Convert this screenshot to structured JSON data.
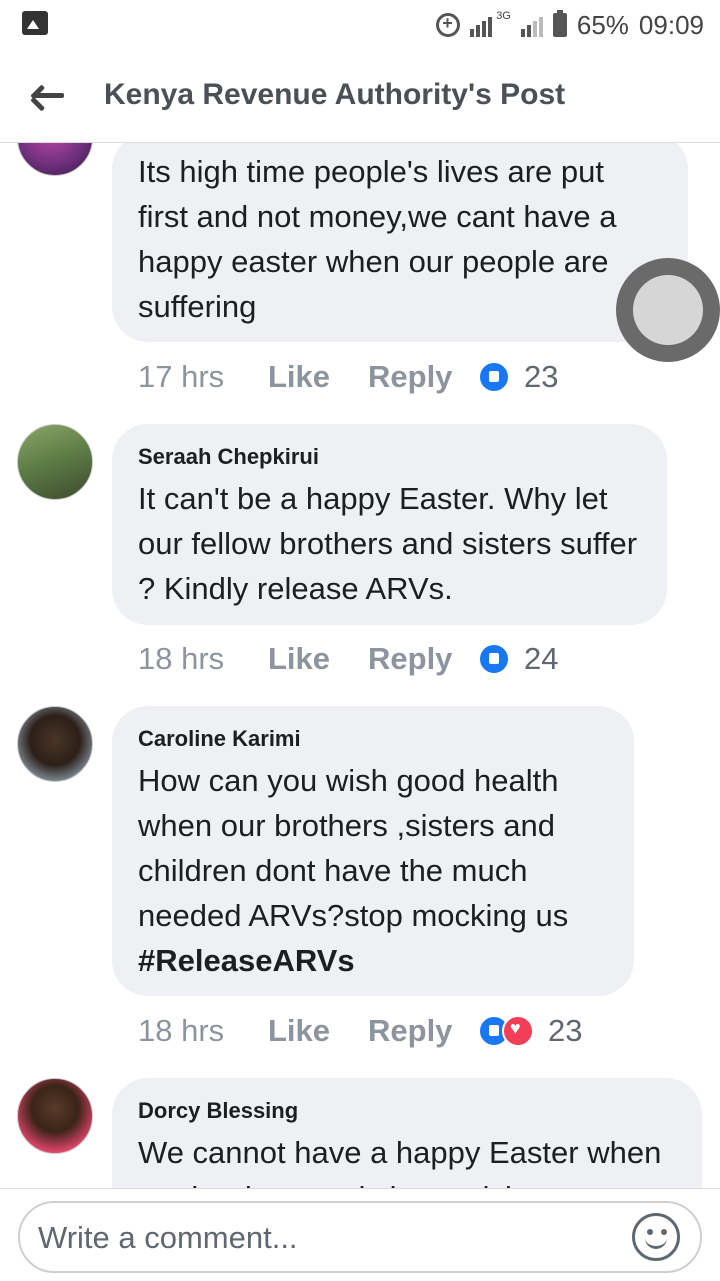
{
  "status_bar": {
    "battery": "65%",
    "time": "09:09",
    "network": "3G"
  },
  "app_bar": {
    "title": "Kenya Revenue Authority's Post"
  },
  "comments": [
    {
      "author": "",
      "text": "Its high time people's lives are put first and not money,we cant have a happy easter when our people are suffering",
      "time": "17 hrs",
      "like": "Like",
      "reply": "Reply",
      "reactions": [
        "like-icon"
      ],
      "count": "23"
    },
    {
      "author": "Seraah Chepkirui",
      "text": "It can't be a happy Easter. Why let our fellow brothers and sisters suffer ? Kindly release ARVs.",
      "time": "18 hrs",
      "like": "Like",
      "reply": "Reply",
      "reactions": [
        "like-icon"
      ],
      "count": "24"
    },
    {
      "author": "Caroline Karimi",
      "text": "How can you wish good health when our brothers ,sisters and children dont have the much needed ARVs?stop mocking us",
      "hashtag": "#ReleaseARVs",
      "time": "18 hrs",
      "like": "Like",
      "reply": "Reply",
      "reactions": [
        "like-icon",
        "love-icon"
      ],
      "count": "23"
    },
    {
      "author": "Dorcy Blessing",
      "text": "We cannot have a happy Easter when our brothers and sisters dying"
    }
  ],
  "composer": {
    "placeholder": "Write a comment..."
  }
}
